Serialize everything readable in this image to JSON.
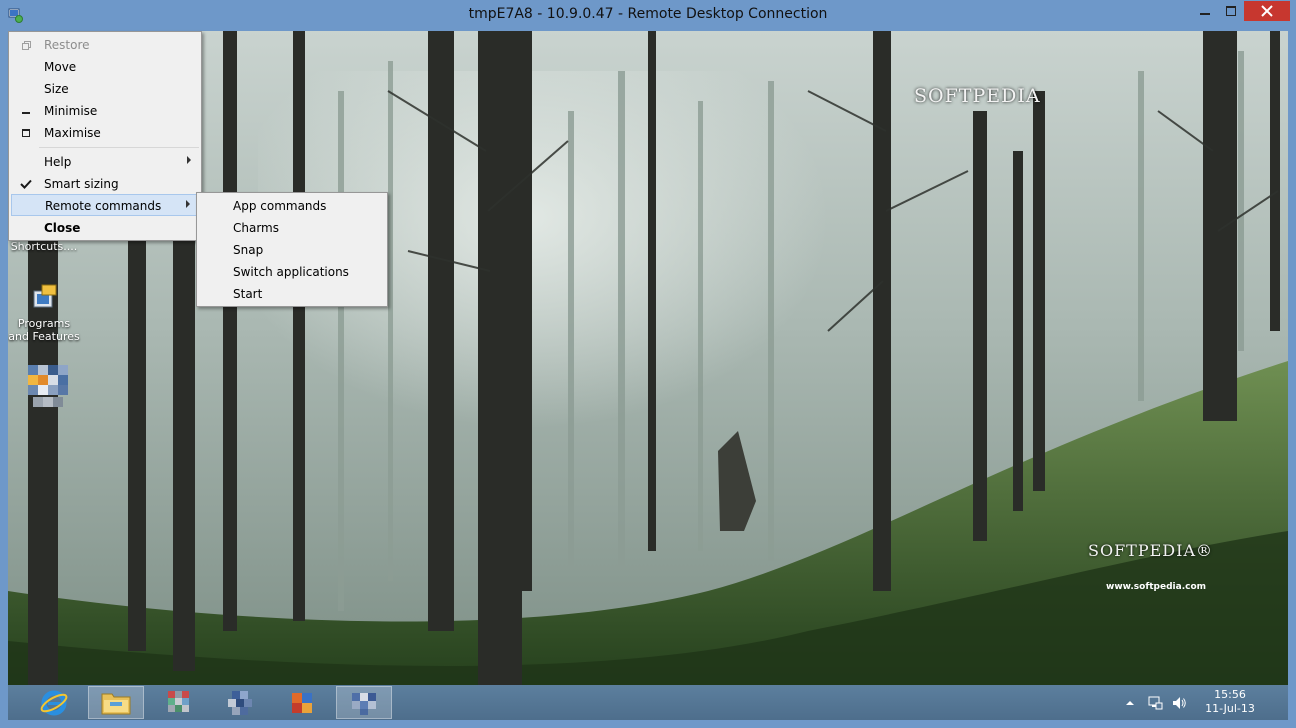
{
  "window": {
    "title": "tmpE7A8 - 10.9.0.47 - Remote Desktop Connection",
    "controls": [
      "minimize-icon",
      "maximize-icon",
      "close-icon"
    ]
  },
  "system_menu": {
    "items": [
      {
        "label": "Restore",
        "state": "disabled",
        "icon": "restore-icon"
      },
      {
        "label": "Move"
      },
      {
        "label": "Size"
      },
      {
        "label": "Minimise",
        "icon": "minimize-icon"
      },
      {
        "label": "Maximise",
        "icon": "maximize-icon"
      },
      {
        "label": "Help",
        "submenu": true
      },
      {
        "label": "Smart sizing",
        "checked": true,
        "icon": "checkmark-icon"
      },
      {
        "label": "Remote commands",
        "submenu": true,
        "highlighted": true
      },
      {
        "label": "Close",
        "bold": true
      }
    ]
  },
  "remote_commands_menu": {
    "items": [
      {
        "label": "App commands"
      },
      {
        "label": "Charms"
      },
      {
        "label": "Snap"
      },
      {
        "label": "Switch applications"
      },
      {
        "label": "Start"
      }
    ]
  },
  "desktop": {
    "icons": [
      {
        "label": "Keyboard Shortcuts....",
        "icon": "keyboard-shortcuts-icon"
      },
      {
        "label": "Programs and Features",
        "icon": "programs-and-features-icon"
      },
      {
        "label": "",
        "icon": "pixelated-shortcut-icon"
      }
    ],
    "watermark": {
      "brand_top": "SOFTPEDIA",
      "brand_bottom": "SOFTPEDIA®",
      "url": "www.softpedia.com"
    }
  },
  "taskbar": {
    "pinned": [
      "internet-explorer-icon",
      "file-explorer-icon",
      "pixelated-app-icon-1",
      "pixelated-app-icon-2",
      "pixelated-app-icon-3",
      "pixelated-app-icon-4"
    ],
    "tray_icons": [
      "show-hidden-icons-chevron",
      "network-icon",
      "volume-icon"
    ],
    "clock": {
      "time": "15:56",
      "date": "11-Jul-13"
    }
  },
  "colors": {
    "frame": "#6e98c9",
    "close_button": "#c7372f",
    "menu_highlight": "#d5e4f6",
    "taskbar": "#56779a"
  }
}
